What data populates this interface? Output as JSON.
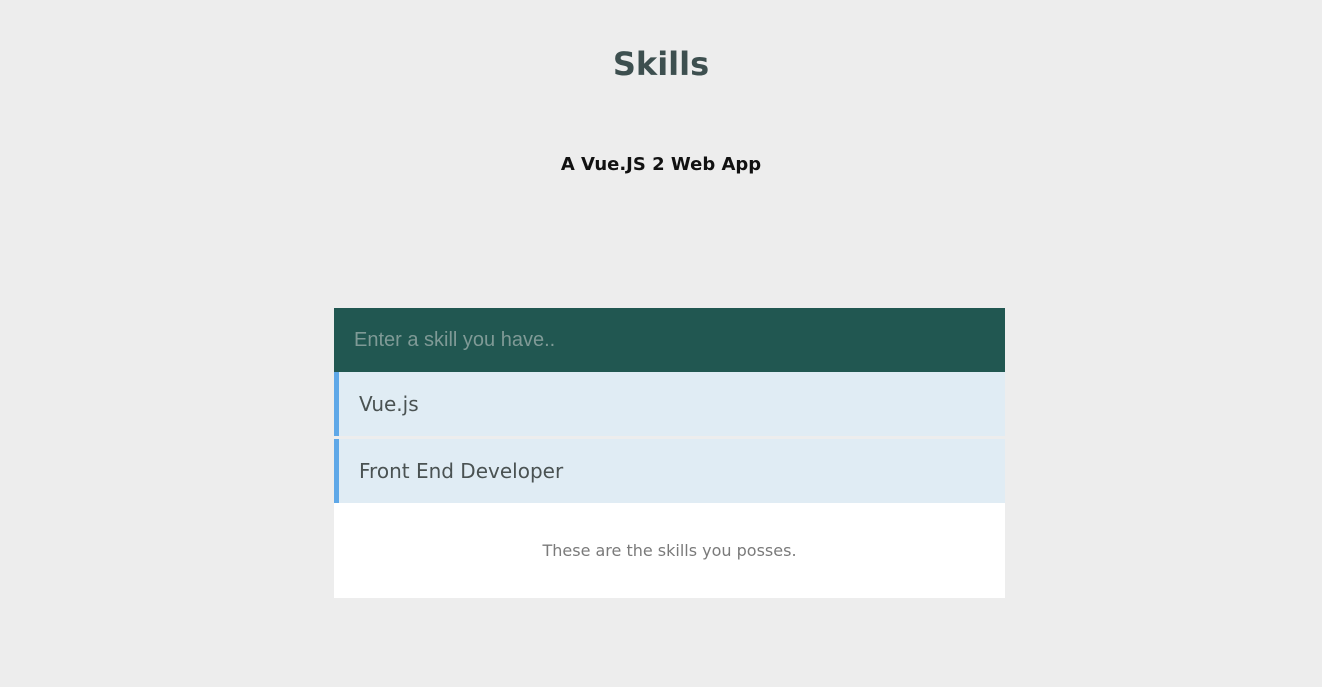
{
  "header": {
    "title": "Skills",
    "subtitle": "A Vue.JS 2 Web App"
  },
  "skills_form": {
    "input_placeholder": "Enter a skill you have..",
    "input_value": ""
  },
  "skills": [
    {
      "label": "Vue.js"
    },
    {
      "label": "Front End Developer"
    }
  ],
  "footer": {
    "text": "These are the skills you posses."
  },
  "colors": {
    "background": "#ededed",
    "input_bar": "#215751",
    "item_background": "#e0ecf4",
    "item_accent": "#5fa8e8",
    "title": "#3d4f4f"
  }
}
